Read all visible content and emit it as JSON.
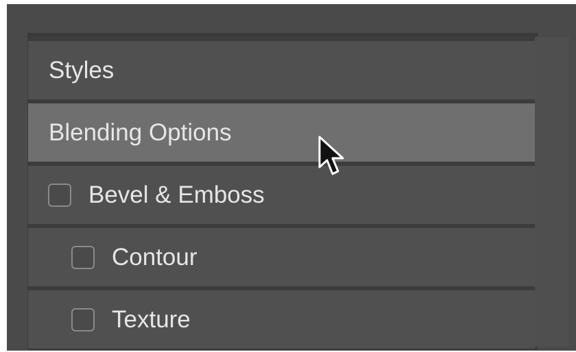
{
  "layer_style": {
    "styles_label": "Styles",
    "blending_options_label": "Blending Options",
    "effects": [
      {
        "label": "Bevel & Emboss",
        "checked": false
      },
      {
        "label": "Contour",
        "checked": false
      },
      {
        "label": "Texture",
        "checked": false
      }
    ]
  },
  "colors": {
    "dialog_bg": "#4a4a4a",
    "row_bg": "#505050",
    "row_selected_bg": "#6f6f6f",
    "text": "#e6e6e6"
  }
}
